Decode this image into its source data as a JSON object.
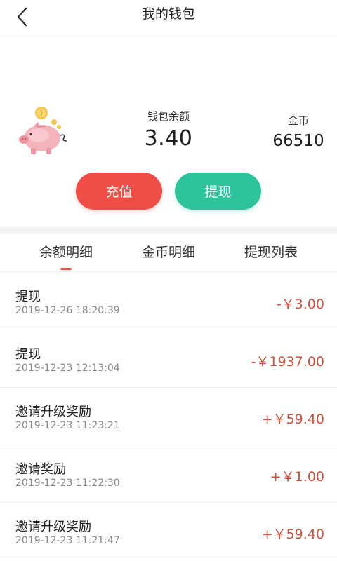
{
  "header": {
    "title": "我的钱包"
  },
  "wallet": {
    "balance_label": "钱包余额",
    "balance_value": "3.40",
    "coin_label": "金币",
    "coin_value": "66510",
    "recharge_label": "充值",
    "withdraw_label": "提现"
  },
  "tabs": [
    {
      "label": "余额明细",
      "active": true
    },
    {
      "label": "金币明细",
      "active": false
    },
    {
      "label": "提现列表",
      "active": false
    }
  ],
  "records": [
    {
      "title": "提现",
      "date": "2019-12-26 18:20:39",
      "amount": "-￥3.00"
    },
    {
      "title": "提现",
      "date": "2019-12-23 12:13:04",
      "amount": "-￥1937.00"
    },
    {
      "title": "邀请升级奖励",
      "date": "2019-12-23 11:23:21",
      "amount": "+￥59.40"
    },
    {
      "title": "邀请奖励",
      "date": "2019-12-23 11:22:30",
      "amount": "+￥1.00"
    },
    {
      "title": "邀请升级奖励",
      "date": "2019-12-23 11:21:47",
      "amount": "+￥59.40"
    }
  ],
  "colors": {
    "accent_red": "#ee4e45",
    "accent_green": "#2cc39d",
    "amount_red": "#d0523c"
  },
  "icons": {
    "back": "chevron-left-icon",
    "piggy": "piggy-bank-icon"
  }
}
